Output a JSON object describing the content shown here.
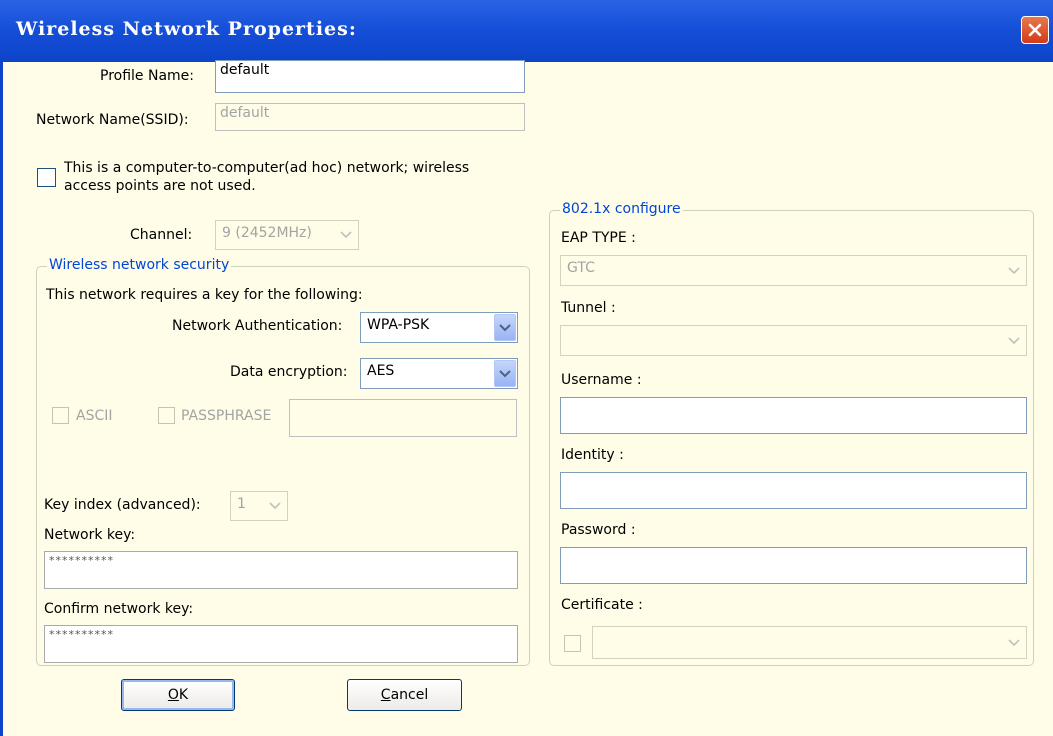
{
  "window": {
    "title": "Wireless Network Properties:"
  },
  "profile": {
    "label": "Profile Name:",
    "value": "default"
  },
  "ssid": {
    "label": "Network Name(SSID):",
    "value": "default"
  },
  "adhoc": {
    "line1": "This is a computer-to-computer(ad hoc) network; wireless",
    "line2": "access points are not used."
  },
  "channel": {
    "label": "Channel:",
    "value": "9  (2452MHz)"
  },
  "security": {
    "legend": "Wireless network security",
    "intro": "This network requires a key for the following:",
    "auth_label": "Network Authentication:",
    "auth_value": "WPA-PSK",
    "enc_label": "Data encryption:",
    "enc_value": "AES",
    "ascii_label": "ASCII",
    "passphrase_label": "PASSPHRASE",
    "keyindex_label": "Key index (advanced):",
    "keyindex_value": "1",
    "netkey_label": "Network key:",
    "netkey_value": "**********",
    "confirm_label": "Confirm network key:",
    "confirm_value": "**********"
  },
  "dot1x": {
    "legend": "802.1x configure",
    "eap_label": "EAP TYPE :",
    "eap_value": "GTC",
    "tunnel_label": "Tunnel :",
    "tunnel_value": "",
    "username_label": "Username :",
    "identity_label": "Identity :",
    "password_label": "Password :",
    "certificate_label": "Certificate :"
  },
  "buttons": {
    "ok_u": "O",
    "ok_rest": "K",
    "cancel_u": "C",
    "cancel_rest": "ancel"
  }
}
